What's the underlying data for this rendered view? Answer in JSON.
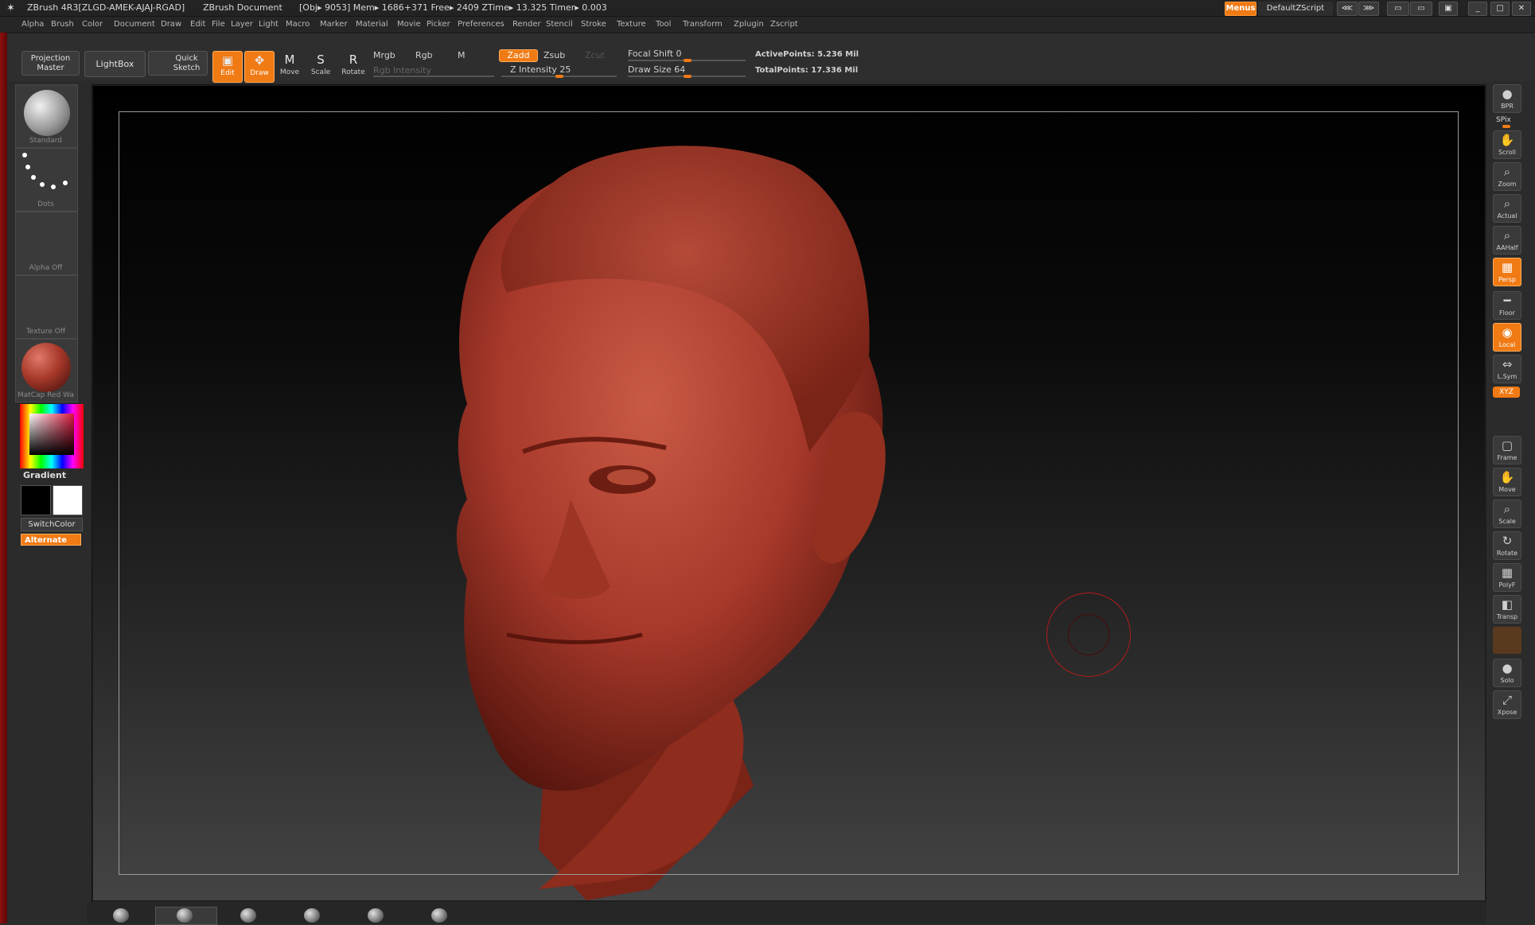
{
  "titlebar": {
    "app": "ZBrush 4R3[ZLGD-AMEK-AJAJ-RGAD]",
    "document": "ZBrush Document",
    "stats": "[Obj▸ 9053] Mem▸ 1686+371 Free▸ 2409 ZTime▸ 13.325 Timer▸ 0.003",
    "menus_btn": "Menus",
    "script_btn": "DefaultZScript"
  },
  "menubar": [
    "Alpha",
    "Brush",
    "Color",
    "Document",
    "Draw",
    "Edit",
    "File",
    "Layer",
    "Light",
    "Macro",
    "Marker",
    "Material",
    "Movie",
    "Picker",
    "Preferences",
    "Render",
    "Stencil",
    "Stroke",
    "Texture",
    "Tool",
    "Transform",
    "Zplugin",
    "Zscript"
  ],
  "shelf": {
    "projection_master": "Projection Master",
    "lightbox": "LightBox",
    "quick_sketch": "Quick Sketch",
    "tools": [
      {
        "label": "Edit",
        "glyph": "▣",
        "active": true
      },
      {
        "label": "Draw",
        "glyph": "✥",
        "active": true
      },
      {
        "label": "Move",
        "glyph": "M",
        "active": false
      },
      {
        "label": "Scale",
        "glyph": "S",
        "active": false
      },
      {
        "label": "Rotate",
        "glyph": "R",
        "active": false
      }
    ],
    "mrgb": "Mrgb",
    "rgb": "Rgb",
    "m": "M",
    "rgb_intensity": "Rgb Intensity",
    "zadd": "Zadd",
    "zsub": "Zsub",
    "zcut": "Zcut",
    "z_intensity": "Z Intensity 25",
    "focal_shift": "Focal Shift 0",
    "draw_size": "Draw Size 64",
    "active_points": "ActivePoints: 5.236 Mil",
    "total_points": "TotalPoints: 17.336 Mil"
  },
  "lefttray": {
    "brush": "Standard",
    "stroke": "Dots",
    "alpha": "Alpha Off",
    "texture": "Texture Off",
    "material": "MatCap Red Wa",
    "gradient": "Gradient",
    "switchcolor": "SwitchColor",
    "alternate": "Alternate"
  },
  "righttray": [
    {
      "label": "BPR",
      "glyph": "●",
      "active": false
    },
    {
      "label": "Scroll",
      "glyph": "✋",
      "active": false
    },
    {
      "label": "Zoom",
      "glyph": "⌕",
      "active": false
    },
    {
      "label": "Actual",
      "glyph": "⌕",
      "active": false
    },
    {
      "label": "AAHalf",
      "glyph": "⌕",
      "active": false
    },
    {
      "label": "Persp",
      "glyph": "▦",
      "active": true
    },
    {
      "label": "Floor",
      "glyph": "━",
      "active": false
    },
    {
      "label": "Local",
      "glyph": "◉",
      "active": true
    },
    {
      "label": "L.Sym",
      "glyph": "⇔",
      "active": false
    },
    {
      "label": "Frame",
      "glyph": "▢",
      "active": false
    },
    {
      "label": "Move",
      "glyph": "✋",
      "active": false
    },
    {
      "label": "Scale",
      "glyph": "⌕",
      "active": false
    },
    {
      "label": "Rotate",
      "glyph": "↻",
      "active": false
    },
    {
      "label": "PolyF",
      "glyph": "▦",
      "active": false
    },
    {
      "label": "Transp",
      "glyph": "◧",
      "active": false
    },
    {
      "label": "Solo",
      "glyph": "●",
      "active": false
    },
    {
      "label": "Xpose",
      "glyph": "⤢",
      "active": false
    }
  ],
  "righttray_extra": {
    "spix": "SPix",
    "xyz": "XYZ"
  },
  "colors": {
    "accent": "#f07a14",
    "clay": "#a8392b"
  }
}
